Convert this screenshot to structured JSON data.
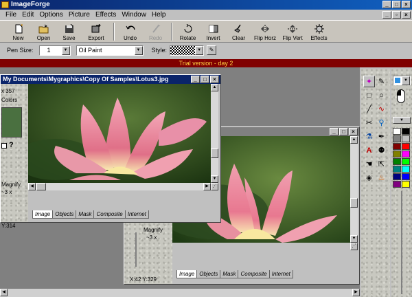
{
  "app": {
    "title": "ImageForge",
    "menus": [
      "File",
      "Edit",
      "Options",
      "Picture",
      "Effects",
      "Window",
      "Help"
    ]
  },
  "toolbar": {
    "new": "New",
    "open": "Open",
    "save": "Save",
    "export": "Export",
    "undo": "Undo",
    "redo": "Redo",
    "rotate": "Rotate",
    "invert": "Invert",
    "clear": "Clear",
    "flip_horz": "Flip Horz",
    "flip_vert": "Flip Vert",
    "effects": "Effects"
  },
  "options": {
    "pen_size_label": "Pen Size:",
    "pen_size_value": "1",
    "brush_value": "Oil Paint",
    "style_label": "Style:"
  },
  "trial_text": "Trial version - day 2",
  "doc1": {
    "title": "My Documents\\Mygraphics\\Copy Of Samples\\Lotus3.jpg",
    "info_size": "x 357",
    "info_colors": "Colors",
    "magnify_label": "Magnify",
    "magnify_value": "~3 x",
    "coords": "Y:314",
    "tabs": [
      "Image",
      "Objects",
      "Mask",
      "Composite",
      "Internet"
    ]
  },
  "doc2": {
    "magnify_label": "Magnify",
    "magnify_value": "~3 x",
    "coords": "X:42 Y:329",
    "tabs": [
      "Image",
      "Objects",
      "Mask",
      "Composite",
      "Internet"
    ]
  },
  "colors": {
    "title_active": "#0a246a",
    "trial_bg": "#800000",
    "trial_fg": "#ffd040",
    "swatches_left": [
      "#ffffff",
      "#808080",
      "#800000",
      "#808000",
      "#008000",
      "#008080",
      "#000080",
      "#800080"
    ],
    "swatches_right": [
      "#000000",
      "#c0c0c0",
      "#ff0000",
      "#ff00ff",
      "#00ff00",
      "#00ffff",
      "#0000ff",
      "#ffff00"
    ],
    "current": "#3090e0"
  }
}
